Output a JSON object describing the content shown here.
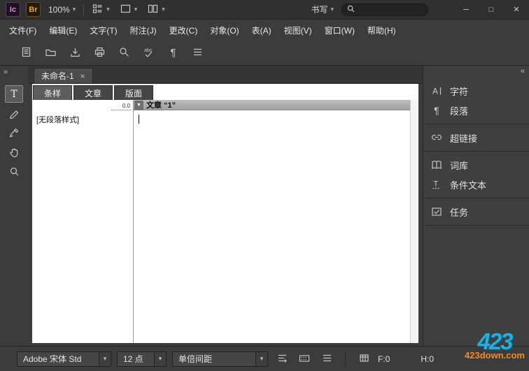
{
  "titlebar": {
    "app_badge": "Ic",
    "bridge_badge": "Br",
    "zoom_level": "100%",
    "writing_mode": "书写"
  },
  "window_controls": {
    "minimize": "─",
    "maximize": "□",
    "close": "✕"
  },
  "glyphs": {
    "chevron_down": "▾",
    "collapse_right": "»",
    "collapse_left": "«",
    "pilcrow": "¶",
    "menu": "≡",
    "triangle_down": "▼",
    "tab_close": "×",
    "type_tool": "T"
  },
  "menubar": {
    "items": [
      "文件(F)",
      "编辑(E)",
      "文字(T)",
      "附注(J)",
      "更改(C)",
      "对象(O)",
      "表(A)",
      "视图(V)",
      "窗口(W)",
      "帮助(H)"
    ]
  },
  "document": {
    "tab_title": "未命名-1",
    "view_tabs": [
      "条样",
      "文章",
      "版面"
    ],
    "active_view_tab": "条样",
    "ruler_value": "0.0",
    "paragraph_style": "[无段落样式]",
    "story_header": "文章 “1”"
  },
  "right_panel": {
    "items": [
      {
        "label": "字符"
      },
      {
        "label": "段落"
      },
      {
        "label": "超链接"
      },
      {
        "label": "词库"
      },
      {
        "label": "条件文本"
      },
      {
        "label": "任务"
      }
    ]
  },
  "statusbar": {
    "font_family": "Adobe 宋体 Std",
    "font_size": "12 点",
    "line_spacing": "单倍间距",
    "fit_label": "F:0",
    "height_label": "H:0"
  },
  "watermark": {
    "logo": "423",
    "site": "423down.com"
  },
  "colors": {
    "watermark_blue": "#2fa9d6",
    "watermark_orange": "#f08a2d",
    "bridge_orange": "#e8a33d"
  }
}
